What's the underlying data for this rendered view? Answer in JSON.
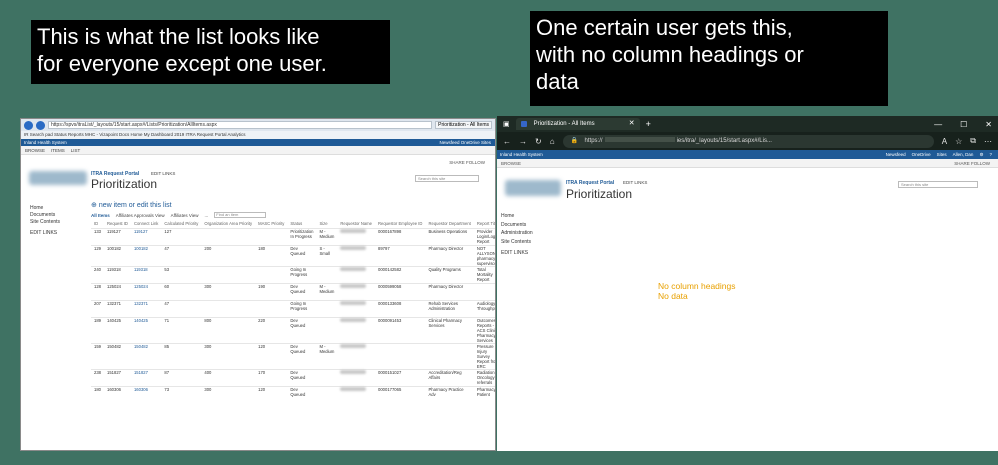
{
  "background_color": "#3f7263",
  "captions": {
    "left": [
      "This is what the list looks like",
      "for everyone except one user."
    ],
    "right": [
      "One certain user gets this,",
      "with no column headings or",
      "data"
    ]
  },
  "left_shot": {
    "address": "https://spvs/itraList/_layouts/15/start.aspx#/Lists/Prioritization/AllItems.aspx",
    "tab_label": "Prioritization - All Items",
    "favorites_bar": "IR Search pad   Status Reports   MHC - Vizapoint Docs   Home   My Dashboard   2019 ITRA Request Portal   Analytics",
    "suite_left": "Inland Health System",
    "suite_right": "Newsfeed   OneDrive   Sites",
    "ribbon": [
      "BROWSE",
      "ITEMS",
      "LIST"
    ],
    "portal": "ITRA Request Portal",
    "edit_links": "EDIT LINKS",
    "share_follow": "SHARE   FOLLOW",
    "search_placeholder": "Search this site",
    "title": "Prioritization",
    "nav": [
      "Home",
      "Documents",
      "Site Contents"
    ],
    "nav_edit": "EDIT LINKS",
    "new_item": "new item or edit this list",
    "views": [
      "All Items",
      "Affiliates Approvals View",
      "Affiliates View",
      "..."
    ],
    "find_placeholder": "Find an item",
    "columns": [
      "ID",
      "Request ID",
      "Connect Link",
      "Calculated Priority",
      "Organization Area Priority",
      "MASC Priority",
      "Status",
      "Size",
      "Requestor Name",
      "Requestor Employee ID",
      "Requestor Department",
      "Report Title"
    ],
    "rows": [
      {
        "id": "133",
        "req": "119127",
        "link": "119127",
        "calc": "127",
        "org": "",
        "masc": "",
        "status": "Prioritization In Progress",
        "size": "M - Medium",
        "emp": "0000167898",
        "dept": "Business Operations",
        "title": "Provider Login/Logout Report"
      },
      {
        "id": "129",
        "req": "100182",
        "link": "100182",
        "calc": "47",
        "org": "200",
        "masc": "180",
        "status": "Dev Queued",
        "size": "S - Small",
        "emp": "89797",
        "dept": "Pharmacy Director",
        "title": "NOT ALLYSON'S pharmacy supervisor"
      },
      {
        "id": "240",
        "req": "119318",
        "link": "119318",
        "calc": "53",
        "org": "",
        "masc": "",
        "status": "Going In Progress",
        "size": "",
        "emp": "0000142582",
        "dept": "Quality Programs",
        "title": "Total Mortality Report"
      },
      {
        "id": "128",
        "req": "125024",
        "link": "125024",
        "calc": "60",
        "org": "300",
        "masc": "190",
        "status": "Dev Queued",
        "size": "M - Medium",
        "emp": "0000599058",
        "dept": "Pharmacy Director",
        "title": ""
      },
      {
        "id": "207",
        "req": "132371",
        "link": "132371",
        "calc": "47",
        "org": "",
        "masc": "",
        "status": "Going In Progress",
        "size": "",
        "emp": "0000133608",
        "dept": "Rehab Services Administration",
        "title": "Audiology Throughput"
      },
      {
        "id": "189",
        "req": "140425",
        "link": "140425",
        "calc": "71",
        "org": "800",
        "masc": "220",
        "status": "Dev Queued",
        "size": "",
        "emp": "0000091453",
        "dept": "Clinical Pharmacy Services",
        "title": "Outcomes Reports - ACS Clinical Pharmacy Services"
      },
      {
        "id": "159",
        "req": "150482",
        "link": "150482",
        "calc": "85",
        "org": "300",
        "masc": "120",
        "status": "Dev Queued",
        "size": "M - Medium",
        "emp": "",
        "dept": "",
        "title": "Pressure Injury Survey Report from ERC"
      },
      {
        "id": "238",
        "req": "151827",
        "link": "151827",
        "calc": "87",
        "org": "400",
        "masc": "170",
        "status": "Dev Queued",
        "size": "",
        "emp": "0000151027",
        "dept": "Accreditation/Reg Affairs",
        "title": "Radiation Oncology referrals"
      },
      {
        "id": "180",
        "req": "160306",
        "link": "160306",
        "calc": "73",
        "org": "300",
        "masc": "120",
        "status": "Dev Queued",
        "size": "",
        "emp": "0000177065",
        "dept": "Pharmacy Practice Adv",
        "title": "Pharmacy Patient"
      }
    ]
  },
  "right_shot": {
    "tab_label": "Prioritization - All Items",
    "url_prefix": "https://",
    "url_suffix": "ies/itra/_layouts/15/start.aspx#/Lis...",
    "suite_left": "Inland Health System",
    "suite_right": [
      "Newsfeed",
      "OneDrive",
      "Sites",
      "Allen, Dan"
    ],
    "browse": "BROWSE",
    "share_follow": "SHARE   FOLLOW",
    "portal": "ITRA Request Portal",
    "edit_links": "EDIT LINKS",
    "search_placeholder": "Search this site",
    "title": "Prioritization",
    "nav": [
      "Home",
      "Documents",
      "Administration",
      "Site Contents"
    ],
    "nav_edit": "EDIT LINKS",
    "message": [
      "No column headings",
      "No data"
    ]
  }
}
